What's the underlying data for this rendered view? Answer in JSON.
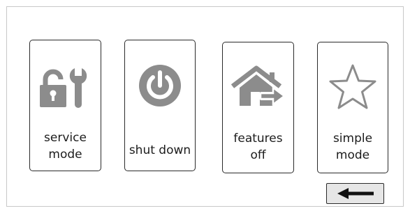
{
  "tiles": [
    {
      "label": "service\nmode",
      "icon": "lock-wrench-icon"
    },
    {
      "label": "shut down",
      "icon": "power-icon"
    },
    {
      "label": "features\noff",
      "icon": "home-exit-icon"
    },
    {
      "label": "simple\nmode",
      "icon": "star-icon"
    }
  ],
  "back_button": {
    "icon": "arrow-left-icon"
  },
  "colors": {
    "icon_gray": "#8c8c8c",
    "border": "#2a2a2a",
    "button_bg": "#e6e6e6"
  }
}
